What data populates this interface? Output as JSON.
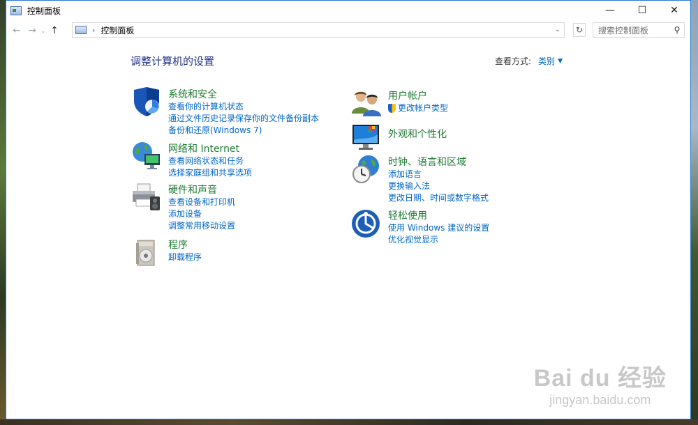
{
  "window": {
    "title": "控制面板",
    "controls": {
      "minimize": "—",
      "maximize": "☐",
      "close": "✕"
    }
  },
  "nav": {
    "back": "←",
    "forward": "→",
    "recent": "⌄",
    "up": "↑",
    "breadcrumb": "控制面板",
    "search_placeholder": "搜索控制面板"
  },
  "header": {
    "title": "调整计算机的设置",
    "view_by_label": "查看方式:",
    "view_by_value": "类别"
  },
  "categories": [
    {
      "title": "系统和安全",
      "icon": "shield-icon",
      "links": [
        "查看你的计算机状态",
        "通过文件历史记录保存你的文件备份副本",
        "备份和还原(Windows 7)"
      ]
    },
    {
      "title": "网络和 Internet",
      "icon": "network-globe-icon",
      "links": [
        "查看网络状态和任务",
        "选择家庭组和共享选项"
      ]
    },
    {
      "title": "硬件和声音",
      "icon": "printer-icon",
      "links": [
        "查看设备和打印机",
        "添加设备",
        "调整常用移动设置"
      ]
    },
    {
      "title": "程序",
      "icon": "programs-icon",
      "links": [
        "卸载程序"
      ]
    },
    {
      "title": "用户帐户",
      "icon": "users-icon",
      "links": [
        "更改帐户类型"
      ]
    },
    {
      "title": "外观和个性化",
      "icon": "monitor-icon",
      "links": []
    },
    {
      "title": "时钟、语言和区域",
      "icon": "clock-globe-icon",
      "links": [
        "添加语言",
        "更换输入法",
        "更改日期、时间或数字格式"
      ]
    },
    {
      "title": "轻松使用",
      "icon": "ease-of-access-icon",
      "links": [
        "使用 Windows 建议的设置",
        "优化视觉显示"
      ]
    }
  ],
  "watermark": {
    "logo": "Bai du 经验",
    "url": "jingyan.baidu.com"
  },
  "colors": {
    "link": "#0066cc",
    "category": "#1e7a32",
    "heading": "#1e3287"
  }
}
